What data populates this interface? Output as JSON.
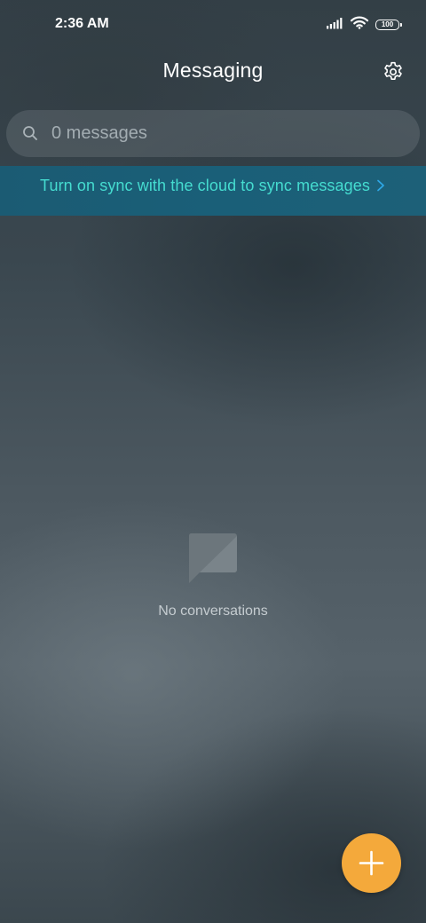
{
  "status_bar": {
    "time": "2:36 AM",
    "battery_level": "100",
    "icons": [
      "signal-icon",
      "wifi-icon",
      "battery-icon"
    ]
  },
  "header": {
    "title": "Messaging",
    "settings_icon": "gear-icon"
  },
  "search": {
    "placeholder": "0 messages",
    "icon": "search-icon"
  },
  "sync_banner": {
    "text": "Turn on sync with the cloud to sync messages",
    "icon": "chevron-right-icon"
  },
  "empty_state": {
    "icon": "message-bubble-icon",
    "label": "No conversations"
  },
  "fab": {
    "icon": "plus-icon"
  },
  "colors": {
    "accent": "#f4a93b",
    "sync_text": "#45dcd0",
    "sync_banner_bg": "#1a5c74",
    "chevron": "#2ea8e6"
  }
}
